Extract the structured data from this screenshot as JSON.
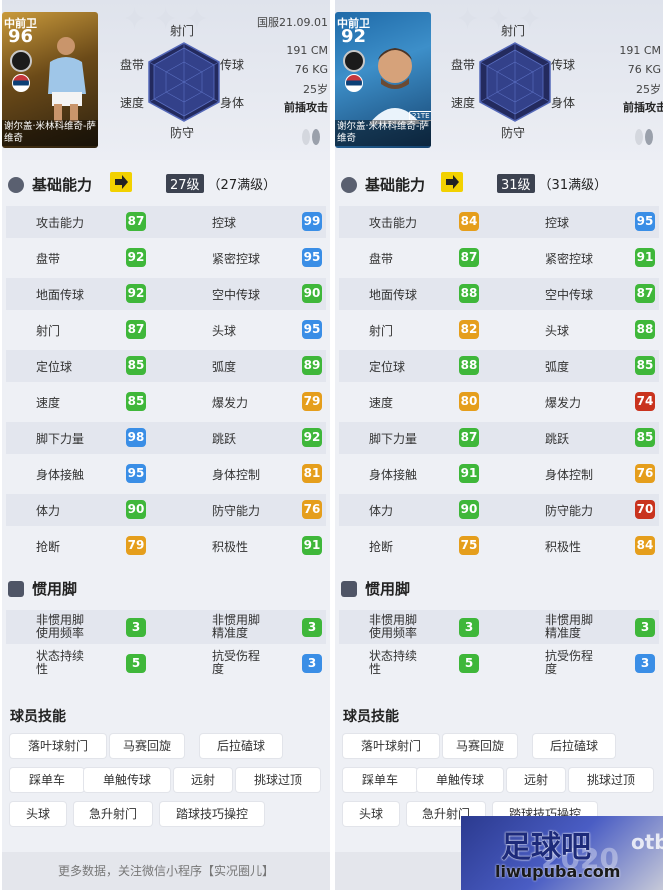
{
  "colors": {
    "green": "#3fb73a",
    "blue": "#3a8ee6",
    "orange": "#e59e1c",
    "red": "#c9331e",
    "panel_bg": "#eef0f5",
    "level_arrow": "#f2d100"
  },
  "left": {
    "card": {
      "position": "中前卫",
      "rating": "96",
      "name": "谢尔盖·米林科维奇-萨维奇"
    },
    "server": "国服21.09.01",
    "radar": {
      "top": "射门",
      "upper_left": "盘带",
      "upper_right": "传球",
      "lower_left": "速度",
      "lower_right": "身体",
      "bottom": "防守"
    },
    "physical": {
      "height": "191 CM",
      "weight": "76 KG",
      "age": "25岁",
      "style": "前插攻击"
    },
    "basic": {
      "title": "基础能力",
      "level": "27级",
      "max_level": "（27满级）"
    },
    "stats": [
      {
        "l1": "攻击能力",
        "v1": "87",
        "c1": "g",
        "l2": "控球",
        "v2": "99",
        "c2": "b"
      },
      {
        "l1": "盘带",
        "v1": "92",
        "c1": "g",
        "l2": "紧密控球",
        "v2": "95",
        "c2": "b"
      },
      {
        "l1": "地面传球",
        "v1": "92",
        "c1": "g",
        "l2": "空中传球",
        "v2": "90",
        "c2": "g"
      },
      {
        "l1": "射门",
        "v1": "87",
        "c1": "g",
        "l2": "头球",
        "v2": "95",
        "c2": "b"
      },
      {
        "l1": "定位球",
        "v1": "85",
        "c1": "g",
        "l2": "弧度",
        "v2": "89",
        "c2": "g"
      },
      {
        "l1": "速度",
        "v1": "85",
        "c1": "g",
        "l2": "爆发力",
        "v2": "79",
        "c2": "o"
      },
      {
        "l1": "脚下力量",
        "v1": "98",
        "c1": "b",
        "l2": "跳跃",
        "v2": "92",
        "c2": "g"
      },
      {
        "l1": "身体接触",
        "v1": "95",
        "c1": "b",
        "l2": "身体控制",
        "v2": "81",
        "c2": "o"
      },
      {
        "l1": "体力",
        "v1": "90",
        "c1": "g",
        "l2": "防守能力",
        "v2": "76",
        "c2": "o"
      },
      {
        "l1": "抢断",
        "v1": "79",
        "c1": "o",
        "l2": "积极性",
        "v2": "91",
        "c2": "g"
      }
    ],
    "foot": {
      "title": "惯用脚",
      "rows": [
        {
          "l1a": "非惯用脚",
          "l1b": "使用频率",
          "v1": "3",
          "c1": "g",
          "l2a": "非惯用脚",
          "l2b": "精准度",
          "v2": "3",
          "c2": "g"
        },
        {
          "l1a": "状态持续",
          "l1b": "性",
          "v1": "5",
          "c1": "g",
          "l2a": "抗受伤程",
          "l2b": "度",
          "v2": "3",
          "c2": "b"
        }
      ]
    },
    "skills": {
      "title": "球员技能",
      "items": [
        "落叶球射门",
        "马赛回旋",
        "后拉磕球",
        "踩单车",
        "单触传球",
        "远射",
        "挑球过顶",
        "头球",
        "急升射门",
        "踏球技巧操控"
      ]
    },
    "bottom_text": "更多数据，关注微信小程序【实况圈儿】"
  },
  "right": {
    "card": {
      "position": "中前卫",
      "rating": "92",
      "name": "谢尔盖·米林科维奇-萨维奇",
      "tag": "21TE"
    },
    "radar": {
      "top": "射门",
      "upper_left": "盘带",
      "upper_right": "传球",
      "lower_left": "速度",
      "lower_right": "身体",
      "bottom": "防守"
    },
    "physical": {
      "height": "191 CM",
      "weight": "76 KG",
      "age": "25岁",
      "style": "前插攻击"
    },
    "basic": {
      "title": "基础能力",
      "level": "31级",
      "max_level": "（31满级）"
    },
    "stats": [
      {
        "l1": "攻击能力",
        "v1": "84",
        "c1": "o",
        "l2": "控球",
        "v2": "95",
        "c2": "b"
      },
      {
        "l1": "盘带",
        "v1": "87",
        "c1": "g",
        "l2": "紧密控球",
        "v2": "91",
        "c2": "g"
      },
      {
        "l1": "地面传球",
        "v1": "88",
        "c1": "g",
        "l2": "空中传球",
        "v2": "87",
        "c2": "g"
      },
      {
        "l1": "射门",
        "v1": "82",
        "c1": "o",
        "l2": "头球",
        "v2": "88",
        "c2": "g"
      },
      {
        "l1": "定位球",
        "v1": "88",
        "c1": "g",
        "l2": "弧度",
        "v2": "85",
        "c2": "g"
      },
      {
        "l1": "速度",
        "v1": "80",
        "c1": "o",
        "l2": "爆发力",
        "v2": "74",
        "c2": "r"
      },
      {
        "l1": "脚下力量",
        "v1": "87",
        "c1": "g",
        "l2": "跳跃",
        "v2": "85",
        "c2": "g"
      },
      {
        "l1": "身体接触",
        "v1": "91",
        "c1": "g",
        "l2": "身体控制",
        "v2": "76",
        "c2": "o"
      },
      {
        "l1": "体力",
        "v1": "90",
        "c1": "g",
        "l2": "防守能力",
        "v2": "70",
        "c2": "r"
      },
      {
        "l1": "抢断",
        "v1": "75",
        "c1": "o",
        "l2": "积极性",
        "v2": "84",
        "c2": "o"
      }
    ],
    "foot": {
      "title": "惯用脚",
      "rows": [
        {
          "l1a": "非惯用脚",
          "l1b": "使用频率",
          "v1": "3",
          "c1": "g",
          "l2a": "非惯用脚",
          "l2b": "精准度",
          "v2": "3",
          "c2": "g"
        },
        {
          "l1a": "状态持续",
          "l1b": "性",
          "v1": "5",
          "c1": "g",
          "l2a": "抗受伤程",
          "l2b": "度",
          "v2": "3",
          "c2": "b"
        }
      ]
    },
    "skills": {
      "title": "球员技能",
      "items": [
        "落叶球射门",
        "马赛回旋",
        "后拉磕球",
        "踩单车",
        "单触传球",
        "远射",
        "挑球过顶",
        "头球",
        "急升射门",
        "踏球技巧操控"
      ]
    },
    "bottom_text": "更多数据，"
  },
  "watermark": {
    "main": "足球吧",
    "url": "liwupuba.com",
    "side": "otb",
    "bg": "2020"
  }
}
